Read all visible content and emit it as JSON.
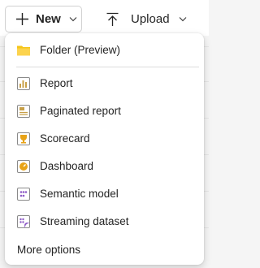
{
  "toolbar": {
    "new_label": "New",
    "upload_label": "Upload"
  },
  "menu": {
    "items": [
      {
        "label": "Folder (Preview)",
        "icon": "folder-icon"
      },
      {
        "label": "Report",
        "icon": "report-icon"
      },
      {
        "label": "Paginated report",
        "icon": "paginated-report-icon"
      },
      {
        "label": "Scorecard",
        "icon": "scorecard-icon"
      },
      {
        "label": "Dashboard",
        "icon": "dashboard-icon"
      },
      {
        "label": "Semantic model",
        "icon": "semantic-model-icon"
      },
      {
        "label": "Streaming dataset",
        "icon": "streaming-dataset-icon"
      }
    ],
    "more_options": "More options"
  },
  "colors": {
    "folder": "#f5c518",
    "report": "#c8a048",
    "scorecard": "#e8a317",
    "dashboard": "#e8a317",
    "semantic": "#8e5bc7"
  }
}
